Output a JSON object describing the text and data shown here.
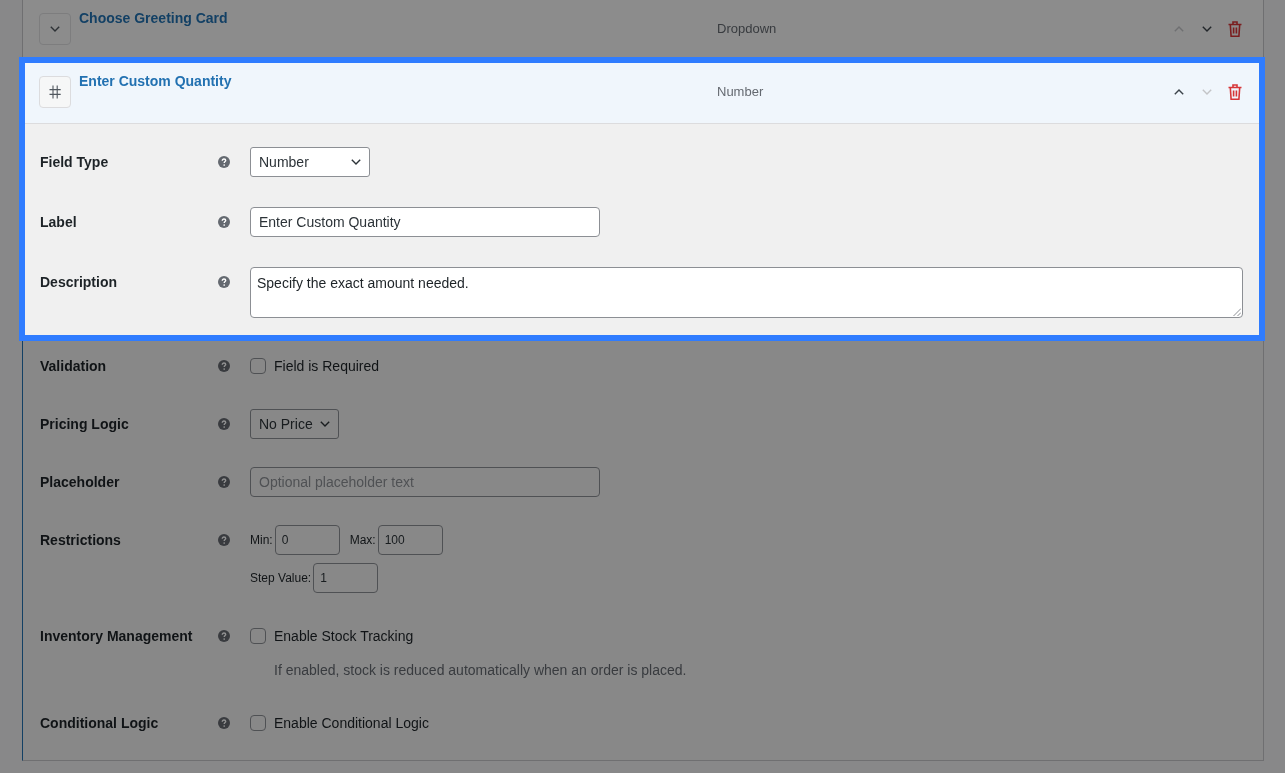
{
  "fields": [
    {
      "title": "Choose Greeting Card",
      "kind": "dropdown",
      "type_label": "Dropdown",
      "expanded": false,
      "highlighted": false,
      "up_disabled": true,
      "down_disabled": false
    },
    {
      "title": "Enter Custom Quantity",
      "kind": "number",
      "type_label": "Number",
      "expanded": true,
      "highlighted": true,
      "up_disabled": false,
      "down_disabled": true,
      "settings": [
        {
          "kind": "field_type",
          "label": "Field Type",
          "value": "Number",
          "highlighted": true
        },
        {
          "kind": "text",
          "label": "Label",
          "value": "Enter Custom Quantity",
          "highlighted": true
        },
        {
          "kind": "textarea",
          "label": "Description",
          "value": "Specify the exact amount needed.",
          "highlighted": true
        },
        {
          "kind": "checkbox",
          "label": "Validation",
          "option": "Field is Required",
          "checked": false,
          "highlighted": false
        },
        {
          "kind": "select",
          "label": "Pricing Logic",
          "value": "No Price",
          "highlighted": false
        },
        {
          "kind": "text",
          "label": "Placeholder",
          "placeholder": "Optional placeholder text",
          "highlighted": false
        },
        {
          "kind": "restrictions",
          "label": "Restrictions",
          "highlighted": false,
          "lines": [
            {
              "inputs": [
                {
                  "label": "Min:",
                  "value": "0"
                },
                {
                  "label": "Max:",
                  "value": "100"
                }
              ]
            },
            {
              "inputs": [
                {
                  "label": "Step Value:",
                  "value": "1"
                }
              ]
            }
          ]
        },
        {
          "kind": "checkbox",
          "label": "Inventory Management",
          "option": "Enable Stock Tracking",
          "checked": false,
          "note": "If enabled, stock is reduced automatically when an order is placed.",
          "highlighted": false
        },
        {
          "kind": "checkbox",
          "label": "Conditional Logic",
          "option": "Enable Conditional Logic",
          "checked": false,
          "highlighted": false
        }
      ]
    }
  ]
}
